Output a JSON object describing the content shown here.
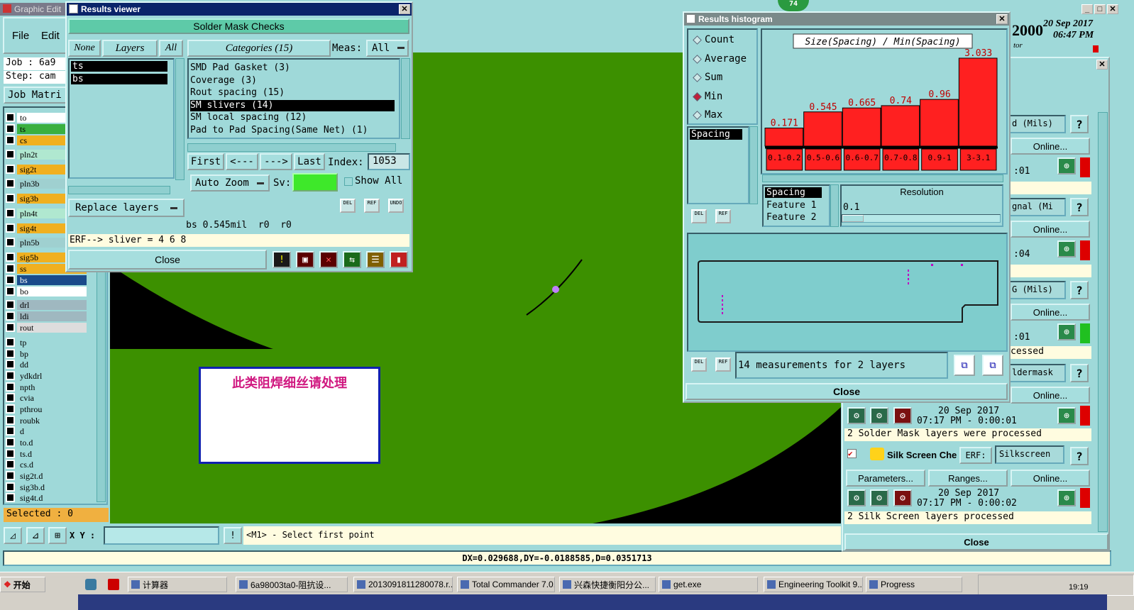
{
  "graphic_editor": {
    "title": "Graphic Edit",
    "menu_file": "File",
    "menu_edit": "Edit",
    "job": "Job : 6a9",
    "step": "Step: cam",
    "job_matrix": "Job Matri",
    "selected": "Selected : 0",
    "xy_label": "X Y :",
    "prompt": "<M1> - Select first point",
    "coords": "DX=0.029688,DY=-0.0188585,D=0.0351713",
    "date_a": "2000",
    "date_b": "20 Sep 2017",
    "time": "06:47 PM",
    "tor": "tor",
    "badge": "74"
  },
  "layers": [
    "to",
    "ts",
    "cs",
    "pln2t",
    "sig2t",
    "pln3b",
    "sig3b",
    "pln4t",
    "sig4t",
    "pln5b",
    "sig5b",
    "ss",
    "bs",
    "bo",
    "drl",
    "ldi",
    "rout",
    "tp",
    "bp",
    "dd",
    "ydkdrl",
    "npth",
    "cvia",
    "pthrou",
    "roubk",
    "d",
    "to.d",
    "ts.d",
    "cs.d",
    "sig2t.d",
    "sig3b.d",
    "sig4t.d"
  ],
  "annotation": "此类阻焊细丝请处理",
  "results_viewer": {
    "title": "Results viewer",
    "heading": "Solder Mask Checks",
    "none": "None",
    "layers": "Layers",
    "all": "All",
    "categories_label": "Categories (15)",
    "meas_label": "Meas:",
    "meas_value": "All",
    "layer_items": [
      "ts",
      "bs"
    ],
    "categories": [
      "SMD Pad Gasket (3)",
      "Coverage (3)",
      "Rout spacing (15)",
      "SM slivers (14)",
      "SM local spacing (12)",
      "Pad to Pad Spacing(Same Net) (1)"
    ],
    "first": "First",
    "prev": "<---",
    "next": "--->",
    "last": "Last",
    "index_label": "Index:",
    "index_value": "1053",
    "auto_zoom": "Auto Zoom",
    "sv": "Sv:",
    "show_all": "Show All",
    "replace_layers": "Replace layers",
    "status": "bs 0.545mil  r0  r0",
    "erf": "ERF--> sliver = 4 6 8",
    "close": "Close"
  },
  "histogram": {
    "title": "Results histogram",
    "modes": [
      "Count",
      "Average",
      "Sum",
      "Min",
      "Max"
    ],
    "selected_mode": "Min",
    "chart_title": "Size(Spacing) / Min(Spacing)",
    "spacing": "Spacing",
    "features": [
      "Spacing",
      "Feature 1",
      "Feature 2"
    ],
    "resolution_label": "Resolution",
    "resolution_value": "0.1",
    "measurements": "14 measurements for 2 layers",
    "close": "Close"
  },
  "chart_data": {
    "type": "bar",
    "title": "Size(Spacing) / Min(Spacing)",
    "categories": [
      "0.1-0.2",
      "0.5-0.6",
      "0.6-0.7",
      "0.7-0.8",
      "0.9-1",
      "3-3.1"
    ],
    "values": [
      0.171,
      0.545,
      0.665,
      0.74,
      0.96,
      3.033
    ],
    "bar_color": "#ff2020"
  },
  "right_panel": {
    "rows": [
      {
        "label": "d (Mils)",
        "online": "Online...",
        "time": ":01"
      },
      {
        "label": "gnal (Mi",
        "online": "Online...",
        "time": ":04"
      },
      {
        "label": "G (Mils)",
        "online": "Online...",
        "time": ":01"
      },
      {
        "label": "ldermask",
        "online": "Online...",
        "time": ""
      }
    ],
    "processed": "cessed",
    "sm_date": "20 Sep 2017",
    "sm_time": "07:17 PM - 0:00:01",
    "sm_status": "2 Solder Mask layers were processed",
    "silk_label": "Silk Screen Che",
    "erf": "ERF:",
    "silk_value": "Silkscreen",
    "parameters": "Parameters...",
    "ranges": "Ranges...",
    "online": "Online...",
    "silk_date": "20 Sep 2017",
    "silk_time": "07:17 PM - 0:00:02",
    "silk_status": "2 Silk Screen layers processed",
    "close": "Close"
  },
  "taskbar": {
    "start": "开始",
    "items": [
      "计算器",
      "6a98003ta0-阻抗设...",
      "2013091811280078.r...",
      "Total Commander 7.0...",
      "兴森快捷衡阳分公...",
      "get.exe",
      "Engineering Toolkit 9....",
      "Progress"
    ],
    "clock": "19:19"
  }
}
